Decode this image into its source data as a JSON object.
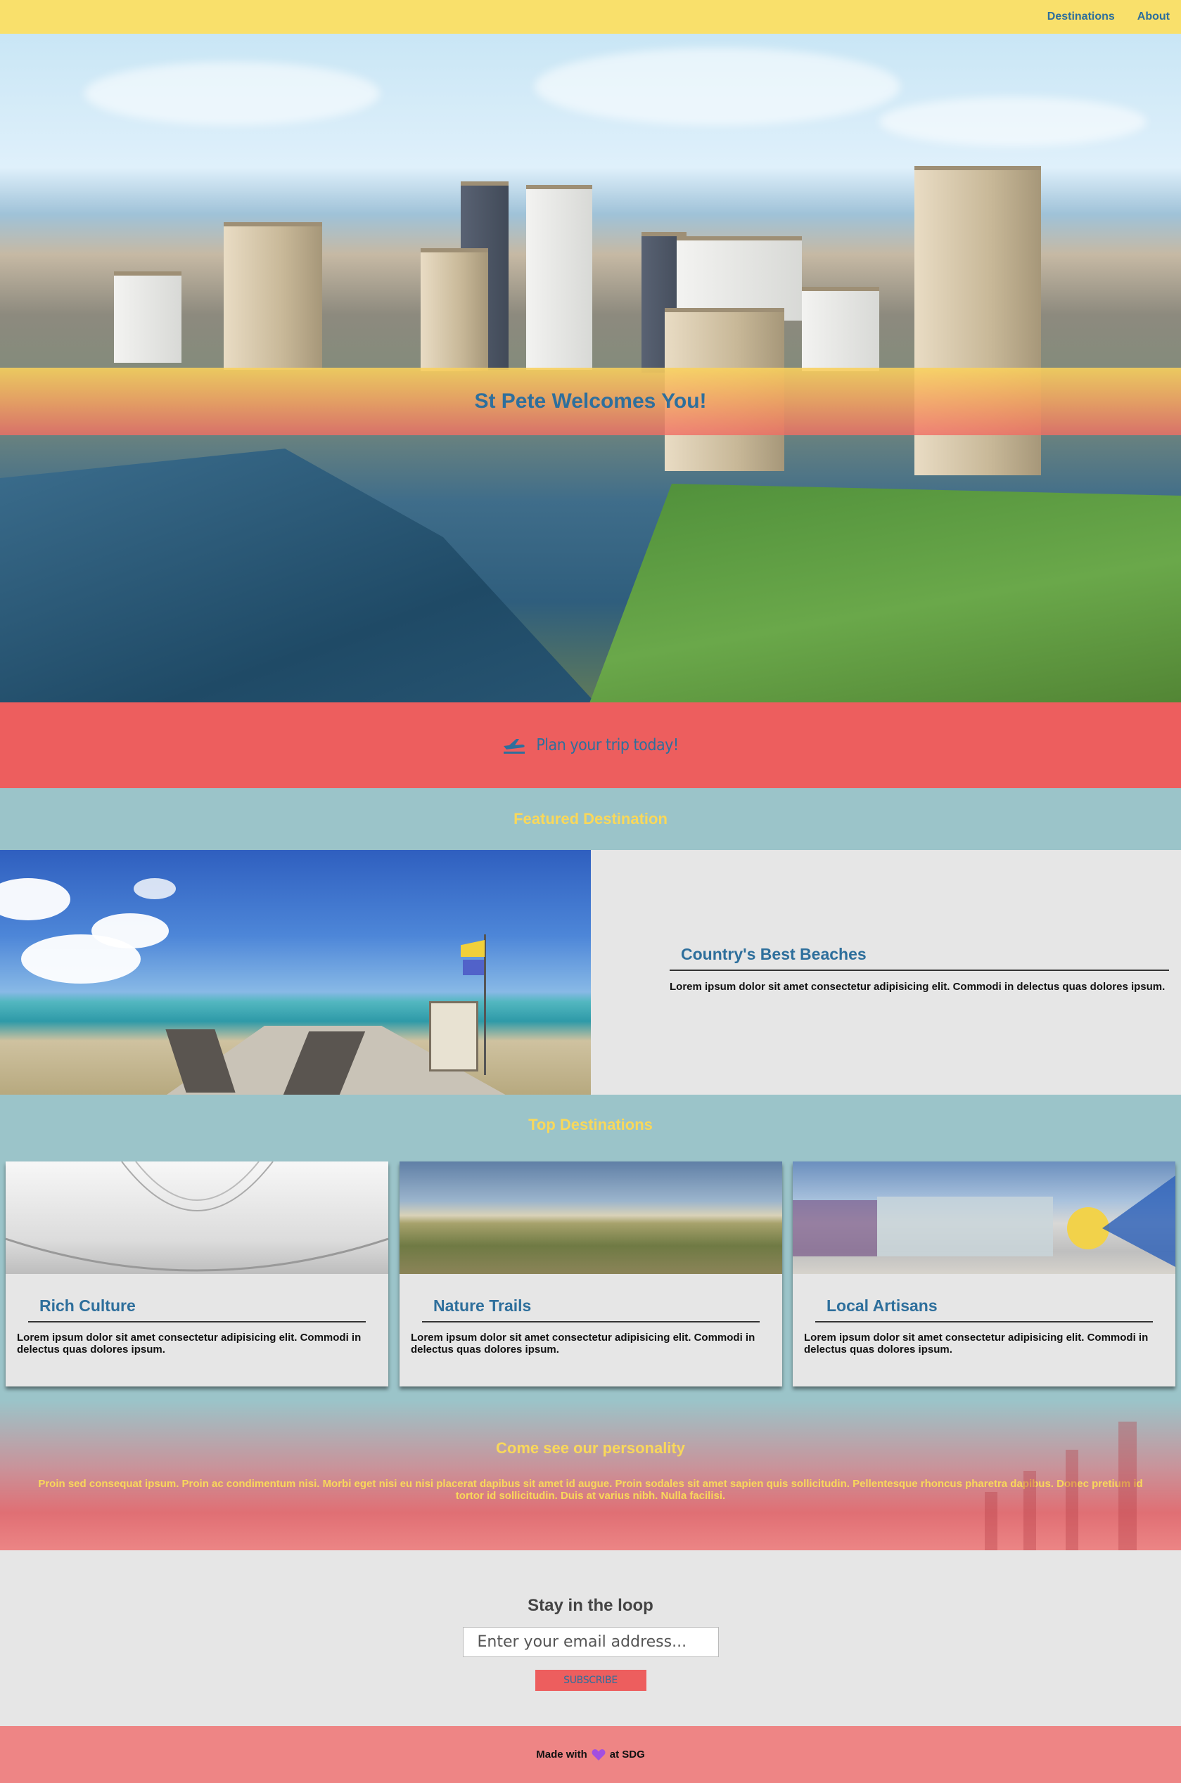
{
  "nav": {
    "items": [
      {
        "label": "Destinations"
      },
      {
        "label": "About"
      }
    ]
  },
  "hero": {
    "title": "St Pete Welcomes You!"
  },
  "plan": {
    "icon": "airplane-icon",
    "label": "Plan your trip today!"
  },
  "featured": {
    "section_title": "Featured Destination",
    "card_title": "Country's Best Beaches",
    "card_text": "Lorem ipsum dolor sit amet consectetur adipisicing elit. Commodi in delectus quas dolores ipsum."
  },
  "top": {
    "section_title": "Top Destinations",
    "cards": [
      {
        "title": "Rich Culture",
        "text": "Lorem ipsum dolor sit amet consectetur adipisicing elit. Commodi in delectus quas dolores ipsum."
      },
      {
        "title": "Nature Trails",
        "text": "Lorem ipsum dolor sit amet consectetur adipisicing elit. Commodi in delectus quas dolores ipsum."
      },
      {
        "title": "Local Artisans",
        "text": "Lorem ipsum dolor sit amet consectetur adipisicing elit. Commodi in delectus quas dolores ipsum."
      }
    ]
  },
  "personality": {
    "title": "Come see our personality",
    "text": "Proin sed consequat ipsum. Proin ac condimentum nisi. Morbi eget nisi eu nisi placerat dapibus sit amet id augue. Proin sodales sit amet sapien quis sollicitudin. Pellentesque rhoncus pharetra dapibus. Donec pretium id tortor id sollicitudin. Duis at varius nibh. Nulla facilisi."
  },
  "newsletter": {
    "title": "Stay in the loop",
    "email_placeholder": "Enter your email address...",
    "subscribe_label": "SUBSCRIBE"
  },
  "footer": {
    "text_before": "Made with",
    "icon": "purple-heart-icon",
    "text_after": "at SDG"
  },
  "colors": {
    "nav_yellow": "#f9e06b",
    "brand_blue": "#2e6f9c",
    "coral": "#ed5e5e",
    "teal": "#9bc4c9",
    "gold_text": "#f9d85a",
    "footer_pink": "#ee8585"
  }
}
